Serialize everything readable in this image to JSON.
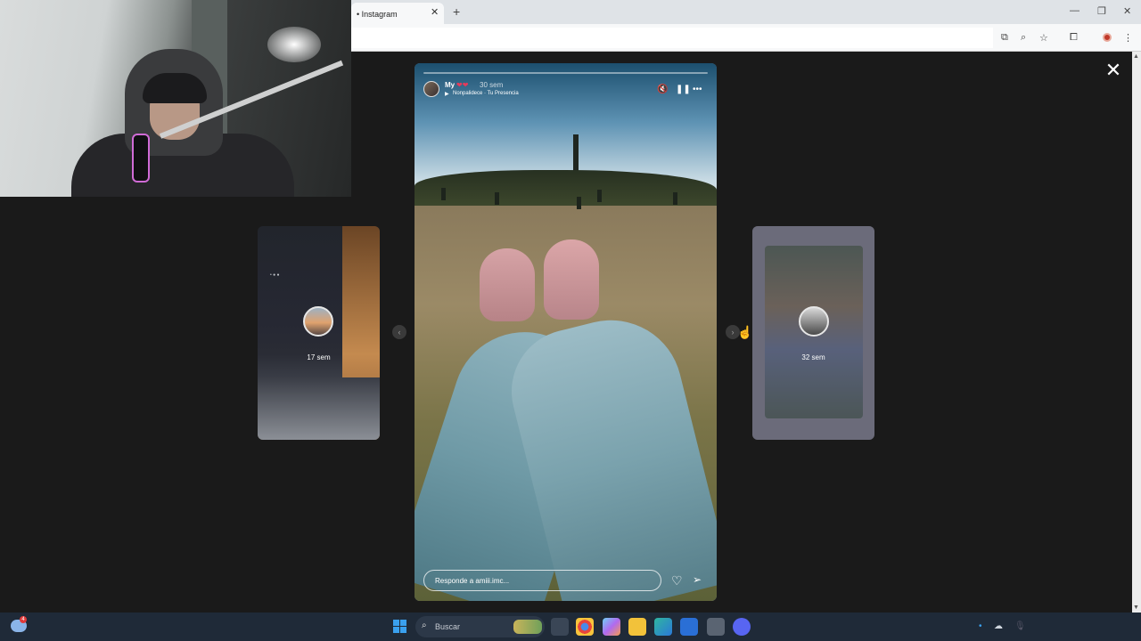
{
  "browser": {
    "tab_title": "• Instagram",
    "tab_close": "✕",
    "new_tab": "+",
    "window_controls": {
      "minimize": "—",
      "restore": "❐",
      "close": "✕"
    }
  },
  "toolbar_icons": [
    "install-icon",
    "zoom-icon",
    "star-icon",
    "extensions-icon",
    "menu-icon"
  ],
  "viewer": {
    "close_label": "✕",
    "prev_preview": {
      "time": "17 sem",
      "caption": "• ●  ●"
    },
    "next_preview": {
      "time": "32 sem"
    },
    "story": {
      "username": "My",
      "emoji": "❤❤",
      "time": "30 sem",
      "music": "Nonpalidece · Tu Presencia",
      "progress": 0.0,
      "reply_placeholder": "Responde a amiii.imc..."
    }
  },
  "taskbar": {
    "search_placeholder": "Buscar",
    "weather_badge": "4",
    "apps": [
      "task-view",
      "chrome",
      "copilot",
      "file-explorer",
      "edge",
      "store",
      "settings",
      "discord"
    ]
  },
  "colors": {
    "viewer_bg": "#1a1a1a",
    "taskbar_bg": "#1f2a38",
    "accent_blue": "#3aa0ee"
  }
}
